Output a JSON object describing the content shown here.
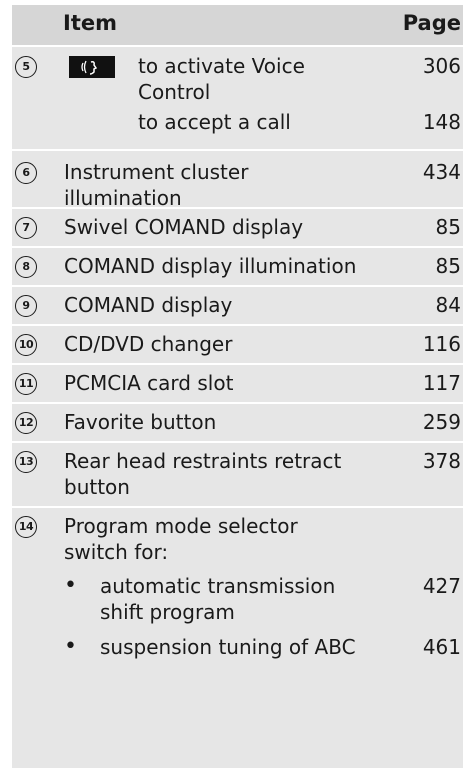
{
  "header": {
    "item": "Item",
    "page": "Page"
  },
  "rows": [
    {
      "num": "5",
      "icon": "voice-control-icon",
      "line1": "to activate Voice",
      "line2": "Control",
      "page1": "306",
      "line3": "to accept a call",
      "page2": "148"
    },
    {
      "num": "6",
      "line1": "Instrument cluster",
      "line2": "illumination",
      "page": "434"
    },
    {
      "num": "7",
      "line1": "Swivel COMAND display",
      "page": "85"
    },
    {
      "num": "8",
      "line1": "COMAND display illumination",
      "page": "85"
    },
    {
      "num": "9",
      "line1": "COMAND display",
      "page": "84"
    },
    {
      "num": "10",
      "line1": "CD/DVD changer",
      "page": "116"
    },
    {
      "num": "11",
      "line1": "PCMCIA card slot",
      "page": "117"
    },
    {
      "num": "12",
      "line1": "Favorite button",
      "page": "259"
    },
    {
      "num": "13",
      "line1": "Rear head restraints retract",
      "line2": "button",
      "page": "378"
    },
    {
      "num": "14",
      "line1": "Program mode selector",
      "line2": "switch for:",
      "bullets": [
        {
          "bullet": "•",
          "line1": "automatic transmission",
          "line2": "shift program",
          "page": "427"
        },
        {
          "bullet": "•",
          "line1": "suspension tuning of ABC",
          "page": "461"
        }
      ]
    }
  ]
}
